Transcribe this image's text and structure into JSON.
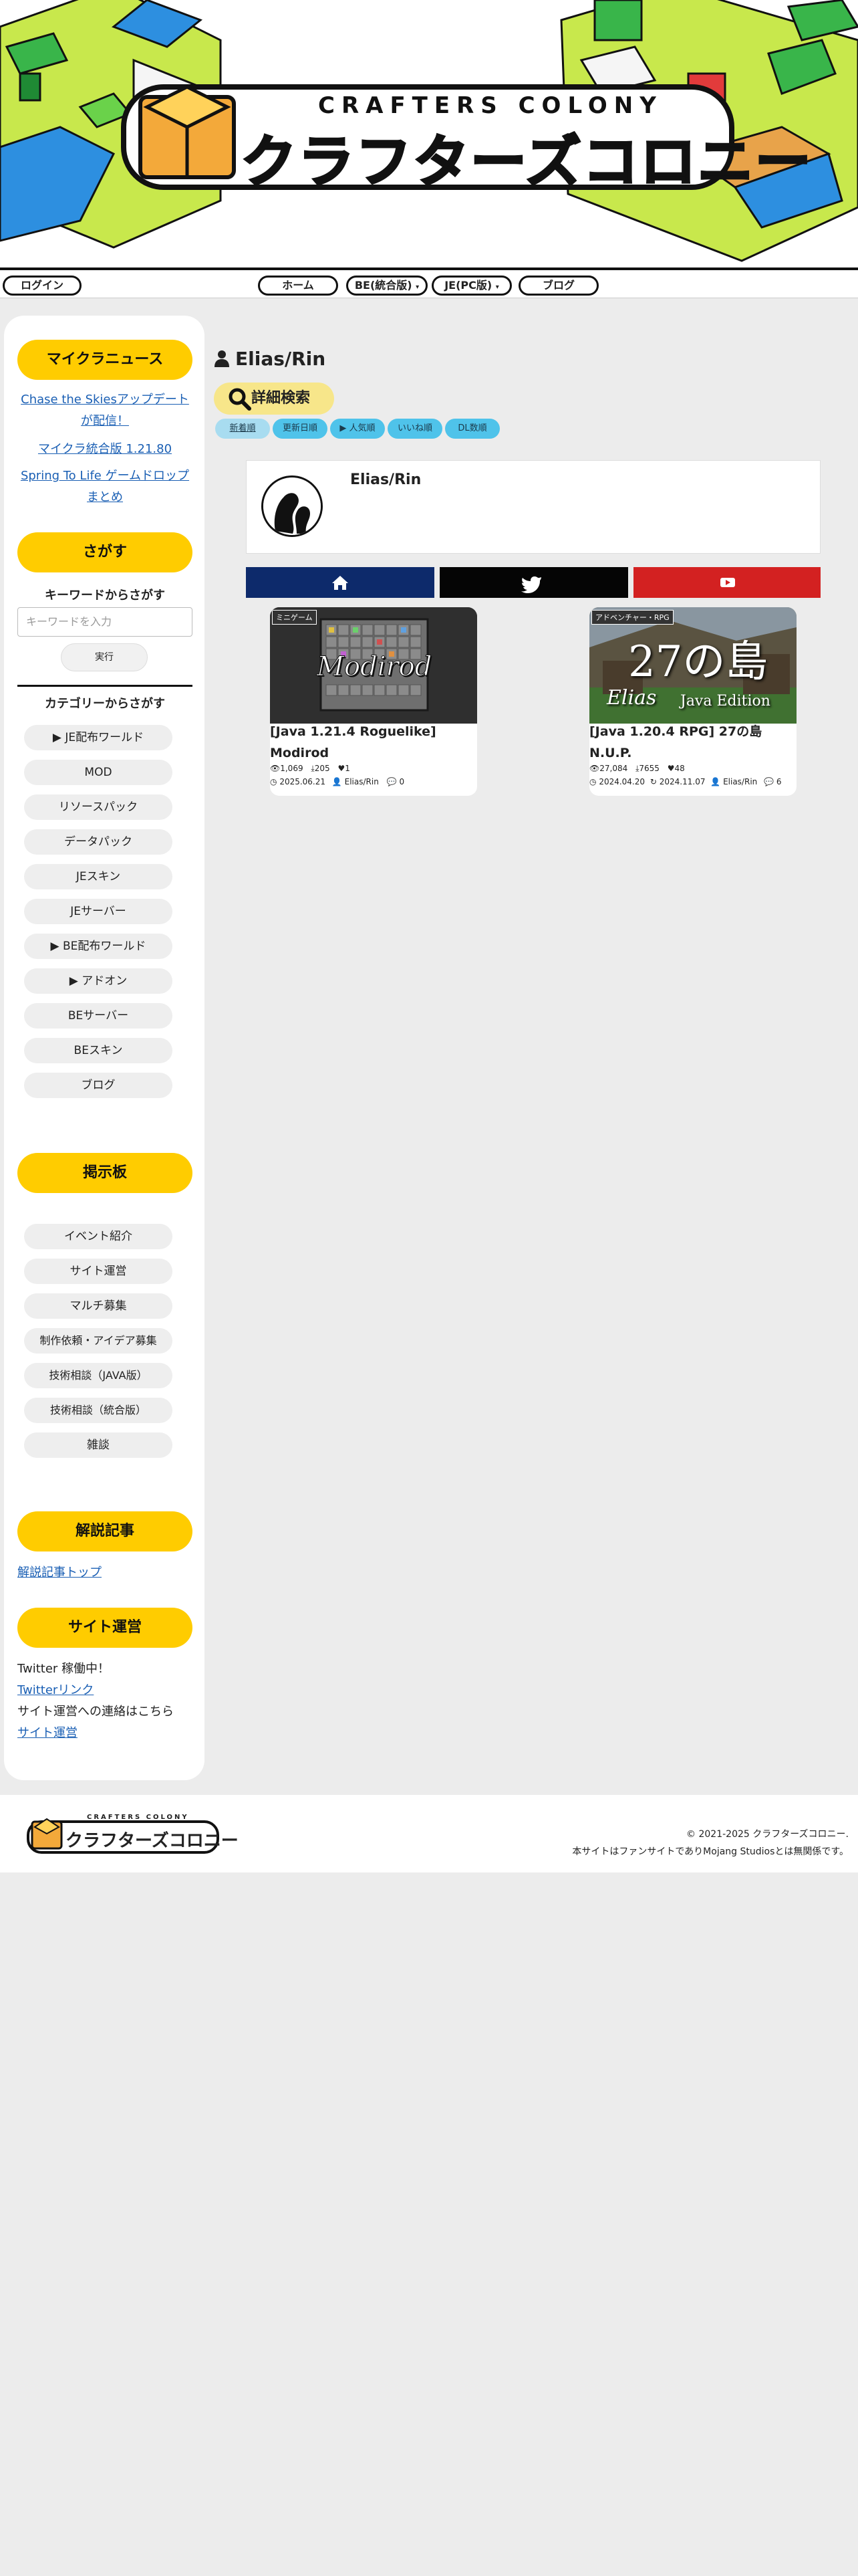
{
  "header": {
    "logo_en": "CRAFTERS COLONY",
    "logo_kana": "クラフターズコロニー"
  },
  "nav": {
    "login": "ログイン",
    "home": "ホーム",
    "be": "BE(統合版)",
    "je": "JE(PC版)",
    "blog": "ブログ"
  },
  "sidebar": {
    "news_head": "マイクラニュース",
    "news_links": [
      "Chase the Skiesアップデートが配信！",
      "マイクラ統合版 1.21.80",
      "Spring To Life ゲームドロップまとめ"
    ],
    "news_link_lines": [
      [
        "Chase the Skiesアップデート",
        "が配信！"
      ],
      [
        "マイクラ統合版 1.21.80"
      ],
      [
        "Spring To Life ゲームドロップ",
        "まとめ"
      ]
    ],
    "search_head": "さがす",
    "keyword_label": "キーワードからさがす",
    "keyword_placeholder": "キーワードを入力",
    "run_label": "実行",
    "category_label": "カテゴリーからさがす",
    "categories": [
      "▶ JE配布ワールド",
      "MOD",
      "リソースパック",
      "データパック",
      "JEスキン",
      "JEサーバー",
      "▶ BE配布ワールド",
      "▶ アドオン",
      "BEサーバー",
      "BEスキン",
      "ブログ"
    ],
    "board_head": "掲示板",
    "board_items": [
      "イベント紹介",
      "サイト運営",
      "マルチ募集",
      "制作依頼・アイデア募集",
      "技術相談（JAVA版）",
      "技術相談（統合版）",
      "雑談"
    ],
    "guide_head": "解説記事",
    "guide_link": "解説記事トップ",
    "ops_head": "サイト運営",
    "ops_twitter_text": "Twitter 稼働中！",
    "ops_twitter_link": "Twitterリンク",
    "ops_contact_text": "サイト運営への連絡はこちら",
    "ops_link": "サイト運営"
  },
  "main": {
    "author": "Elias/Rin",
    "advanced_search": "詳細検索",
    "sorts": [
      "新着順",
      "更新日順",
      "▶ 人気順",
      "いいね順",
      "DL数順"
    ],
    "profile_name": "Elias/Rin",
    "posts": [
      {
        "tag": "ミニゲーム",
        "thumb_text": "Modirod",
        "title": "[Java 1.21.4 Roguelike] Modirod",
        "title_lines": [
          "[Java 1.21.4 Roguelike]",
          "Modirod"
        ],
        "views": "1,069",
        "downloads": "205",
        "likes": "1",
        "date": "2025.06.21",
        "updated": "",
        "author": "Elias/Rin",
        "comments": "0"
      },
      {
        "tag": "アドベンチャー・RPG",
        "thumb_text": "27の島",
        "thumb_sub1": "Elias",
        "thumb_sub2": "Java Edition",
        "title": "[Java 1.20.4 RPG] 27の島 N.U.P.",
        "title_lines": [
          "[Java 1.20.4 RPG] 27の島",
          "N.U.P."
        ],
        "views": "27,084",
        "downloads": "7655",
        "likes": "48",
        "date": "2024.04.20",
        "updated": "2024.11.07",
        "author": "Elias/Rin",
        "comments": "6"
      }
    ]
  },
  "footer": {
    "copyright": "© 2021-2025 クラフターズコロニー.",
    "disclaimer": "本サイトはファンサイトでありMojang Studiosとは無関係です。"
  },
  "colors": {
    "accent": "#ffcc00",
    "link": "#1a5fb4",
    "sort": "#4fc3ea",
    "home_share": "#0d2a6b",
    "twitter_share": "#050505",
    "youtube_share": "#d32121"
  }
}
